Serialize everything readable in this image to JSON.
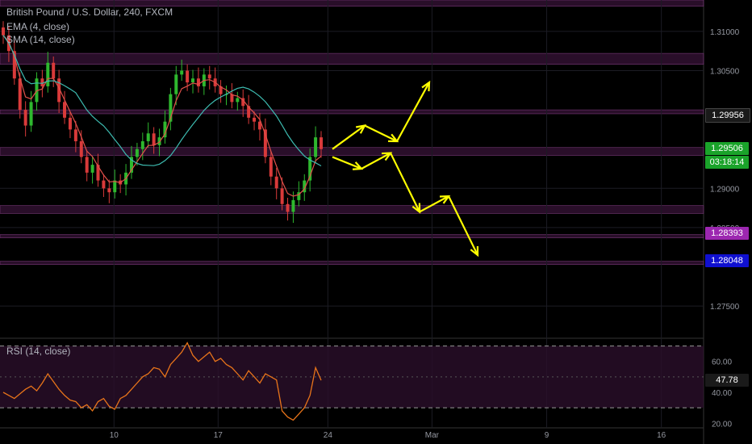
{
  "header": {
    "symbol": "British Pound / U.S. Dollar, 240, FXCM",
    "indicator1": "EMA (4, close)",
    "indicator2": "SMA (14, close)",
    "rsi_label": "RSI (14, close)"
  },
  "colors": {
    "background": "#000000",
    "bull": "#2eb82e",
    "bear": "#d93a3a",
    "ema": "#e0514b",
    "sma": "#3dbbb0",
    "zone": "#5a1e5a",
    "arrow": "#ffff00",
    "rsi": "#e8741a",
    "grid": "#1c1c24"
  },
  "price_tags": [
    {
      "value": "1.29956",
      "bg": "#1a1a1a",
      "color": "#ffffff"
    },
    {
      "value": "1.29506",
      "bg": "#1aa32a",
      "color": "#ffffff"
    },
    {
      "value": "03:18:14",
      "bg": "#1aa32a",
      "color": "#ffffff"
    },
    {
      "value": "1.28393",
      "bg": "#9c27b0",
      "color": "#ffffff"
    },
    {
      "value": "1.28048",
      "bg": "#1010d0",
      "color": "#ffffff"
    }
  ],
  "rsi_tag": {
    "value": "47.78"
  },
  "chart_data": {
    "type": "candlestick",
    "price_axis_ticks": [
      "1.31000",
      "1.30500",
      "1.29000",
      "1.28500",
      "1.27500"
    ],
    "rsi_axis_ticks": [
      "60.00",
      "40.00",
      "20.00"
    ],
    "x_ticks": [
      "10",
      "17",
      "24",
      "Mar",
      "9",
      "16"
    ],
    "price_range": [
      1.271,
      1.314
    ],
    "rsi_range": [
      17,
      75
    ],
    "rsi_bands": [
      30,
      70
    ],
    "close_path": [
      1.3095,
      1.3075,
      1.304,
      1.3,
      1.298,
      1.301,
      1.304,
      1.303,
      1.306,
      1.304,
      1.301,
      1.299,
      1.2975,
      1.296,
      1.294,
      1.292,
      1.293,
      1.291,
      1.29,
      1.2895,
      1.291,
      1.2905,
      1.292,
      1.294,
      1.295,
      1.296,
      1.297,
      1.2955,
      1.2965,
      1.2985,
      1.302,
      1.3045,
      1.305,
      1.3035,
      1.304,
      1.303,
      1.3045,
      1.304,
      1.303,
      1.302,
      1.302,
      1.301,
      1.3015,
      1.3005,
      1.299,
      1.2985,
      1.2975,
      1.294,
      1.2915,
      1.29,
      1.288,
      1.287,
      1.2885,
      1.2895,
      1.291,
      1.294,
      1.2965,
      1.295
    ],
    "rsi_path": [
      40,
      38,
      36,
      39,
      42,
      44,
      41,
      46,
      52,
      47,
      42,
      38,
      35,
      34,
      30,
      32,
      28,
      34,
      36,
      31,
      29,
      36,
      38,
      42,
      46,
      50,
      52,
      56,
      55,
      50,
      58,
      62,
      66,
      72,
      64,
      60,
      63,
      66,
      60,
      62,
      58,
      56,
      52,
      48,
      54,
      50,
      46,
      52,
      50,
      48,
      28,
      24,
      22,
      26,
      30,
      38,
      56,
      47.78
    ],
    "zones": [
      [
        1.314,
        1.3132
      ],
      [
        1.3072,
        1.3058
      ],
      [
        1.3,
        1.2995
      ],
      [
        1.2952,
        1.2942
      ],
      [
        1.2878,
        1.2868
      ],
      [
        1.2841,
        1.2837
      ],
      [
        1.2807,
        1.2803
      ]
    ],
    "annotations": [
      {
        "type": "arrow",
        "points": [
          [
            1.295,
            0
          ],
          [
            1.298,
            1
          ],
          [
            1.296,
            2
          ],
          [
            1.3035,
            3
          ]
        ]
      },
      {
        "type": "arrow",
        "points": [
          [
            1.294,
            0
          ],
          [
            1.2925,
            1
          ],
          [
            1.2945,
            2
          ],
          [
            1.287,
            3
          ],
          [
            1.289,
            4
          ],
          [
            1.2815,
            5
          ]
        ]
      }
    ]
  }
}
